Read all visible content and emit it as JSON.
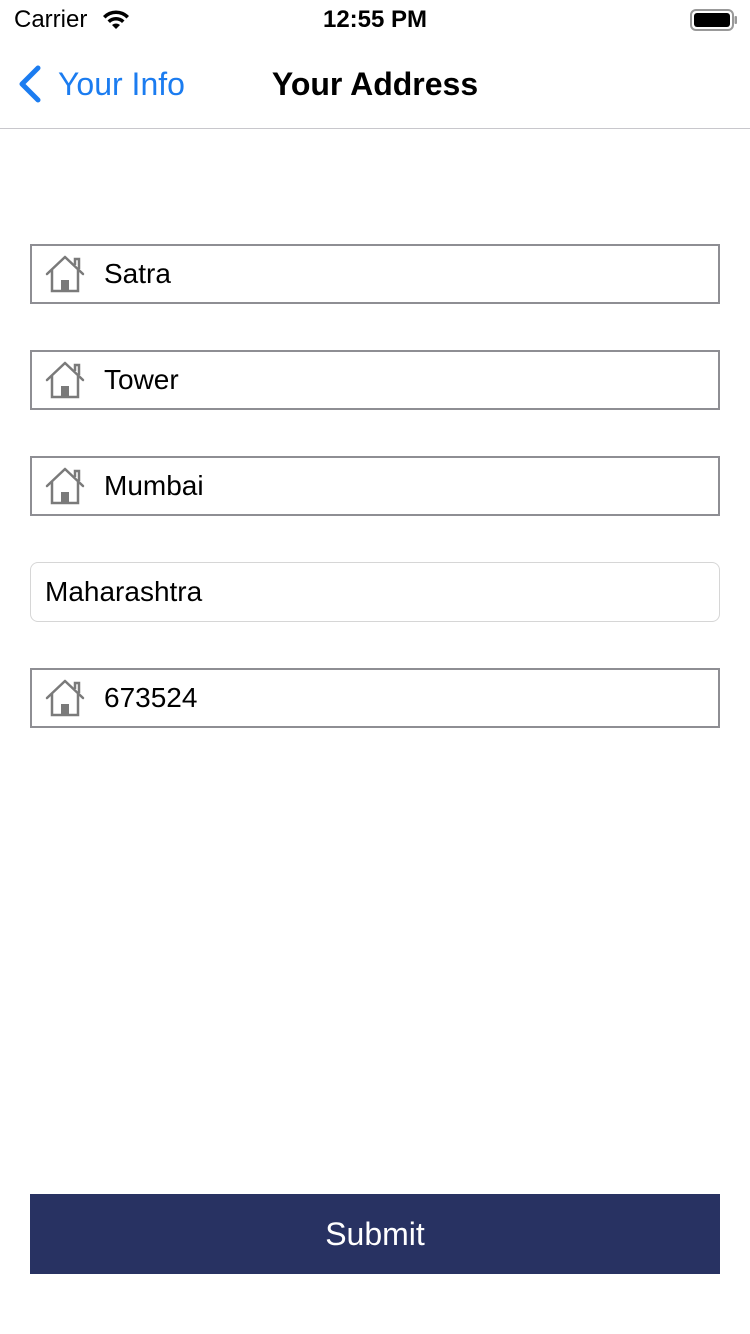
{
  "status_bar": {
    "carrier": "Carrier",
    "time": "12:55 PM",
    "wifi_icon": "wifi-icon",
    "battery_icon": "battery-icon"
  },
  "nav": {
    "back_label": "Your Info",
    "back_icon": "chevron-left-icon",
    "title": "Your Address",
    "accent_color": "#1b7cf0"
  },
  "form": {
    "address_line_1": {
      "value": "Satra",
      "icon": "house-icon"
    },
    "address_line_2": {
      "value": "Tower",
      "icon": "house-icon"
    },
    "city": {
      "value": "Mumbai",
      "icon": "house-icon"
    },
    "state": {
      "value": "Maharashtra"
    },
    "pincode": {
      "value": "673524",
      "icon": "house-icon"
    }
  },
  "submit": {
    "label": "Submit",
    "background": "#283262"
  }
}
